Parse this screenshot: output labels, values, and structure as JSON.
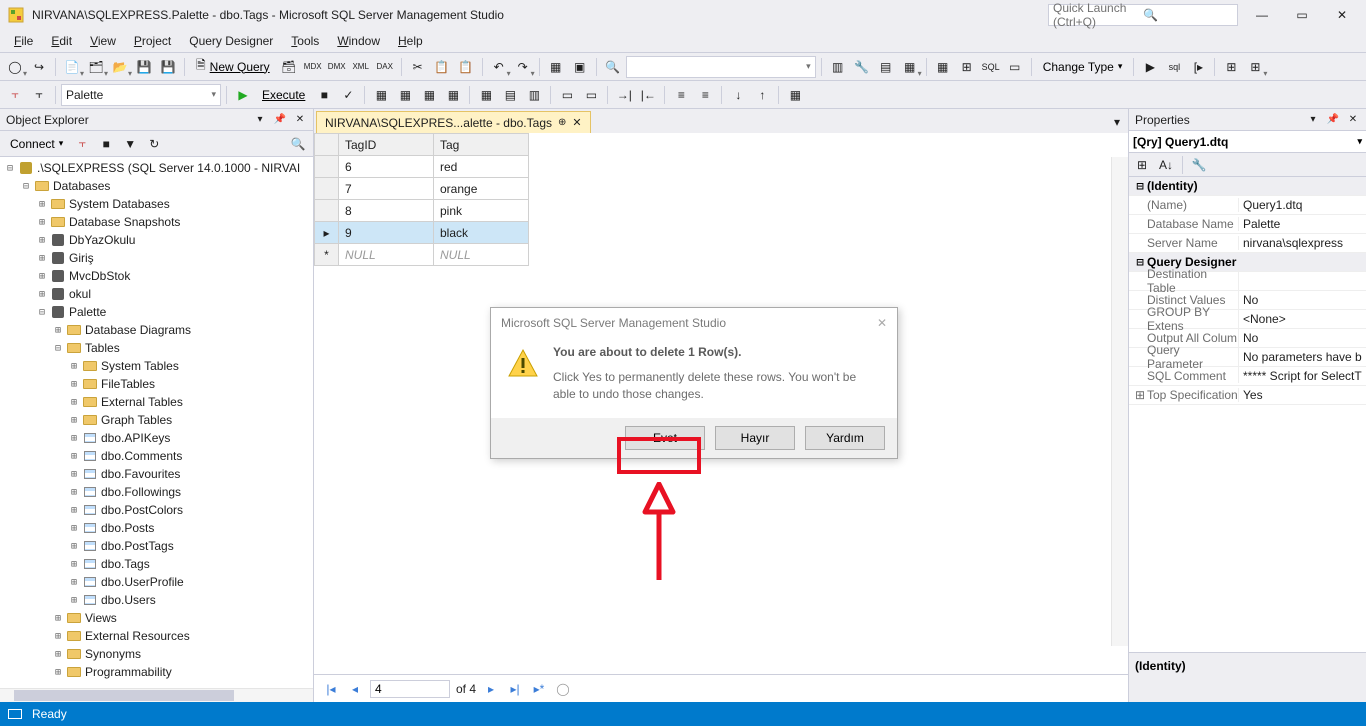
{
  "app": {
    "title": "NIRVANA\\SQLEXPRESS.Palette - dbo.Tags - Microsoft SQL Server Management Studio",
    "quick_launch_placeholder": "Quick Launch (Ctrl+Q)"
  },
  "menu": [
    "File",
    "Edit",
    "View",
    "Project",
    "Query Designer",
    "Tools",
    "Window",
    "Help"
  ],
  "toolbar": {
    "new_query": "New Query",
    "execute": "Execute",
    "change_type": "Change Type",
    "filter_combo": "Palette",
    "combo_blank": ""
  },
  "object_explorer": {
    "title": "Object Explorer",
    "connect": "Connect",
    "root": ".\\SQLEXPRESS (SQL Server 14.0.1000 - NIRVAI",
    "databases": "Databases",
    "sys_db": "System Databases",
    "snapshots": "Database Snapshots",
    "db_list": [
      "DbYazOkulu",
      "Giriş",
      "MvcDbStok",
      "okul",
      "Palette"
    ],
    "palette_children": [
      "Database Diagrams",
      "Tables"
    ],
    "table_folders": [
      "System Tables",
      "FileTables",
      "External Tables",
      "Graph Tables"
    ],
    "tables": [
      "dbo.APIKeys",
      "dbo.Comments",
      "dbo.Favourites",
      "dbo.Followings",
      "dbo.PostColors",
      "dbo.Posts",
      "dbo.PostTags",
      "dbo.Tags",
      "dbo.UserProfile",
      "dbo.Users"
    ],
    "after_tables": [
      "Views",
      "External Resources",
      "Synonyms",
      "Programmability"
    ]
  },
  "doc": {
    "tab_label": "NIRVANA\\SQLEXPRES...alette - dbo.Tags",
    "columns": [
      "TagID",
      "Tag"
    ],
    "rows": [
      {
        "id": "6",
        "tag": "red"
      },
      {
        "id": "7",
        "tag": "orange"
      },
      {
        "id": "8",
        "tag": "pink"
      },
      {
        "id": "9",
        "tag": "black"
      }
    ],
    "null": "NULL",
    "nav_pos": "4",
    "nav_total": "of 4"
  },
  "dialog": {
    "title": "Microsoft SQL Server Management Studio",
    "line1": "You are about to delete 1 Row(s).",
    "line2": "Click Yes to permanently delete these rows. You won't be able to undo those changes.",
    "yes": "Evet",
    "no": "Hayır",
    "help": "Yardım"
  },
  "properties": {
    "title": "Properties",
    "selector": "[Qry] Query1.dtq",
    "cat_identity": "(Identity)",
    "name_lbl": "(Name)",
    "name_val": "Query1.dtq",
    "dbname_lbl": "Database Name",
    "dbname_val": "Palette",
    "server_lbl": "Server Name",
    "server_val": "nirvana\\sqlexpress",
    "cat_qd": "Query Designer",
    "dest_lbl": "Destination Table",
    "dest_val": "",
    "distinct_lbl": "Distinct Values",
    "distinct_val": "No",
    "group_lbl": "GROUP BY Extens",
    "group_val": "<None>",
    "outall_lbl": "Output All Colum",
    "outall_val": "No",
    "qparam_lbl": "Query Parameter",
    "qparam_val": "No parameters have b",
    "sqlc_lbl": "SQL Comment",
    "sqlc_val": "***** Script for SelectT",
    "top_lbl": "Top Specification",
    "top_val": "Yes",
    "footer": "(Identity)"
  },
  "status": {
    "ready": "Ready"
  }
}
